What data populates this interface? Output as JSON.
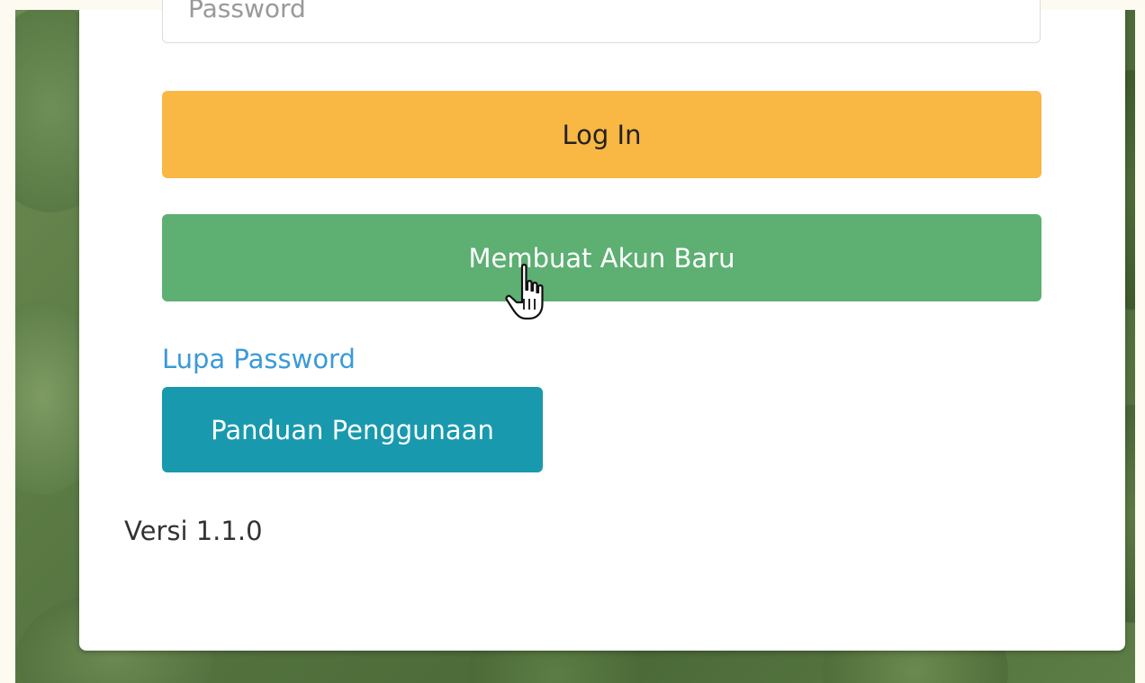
{
  "form": {
    "password_placeholder": "Password",
    "login_label": "Log In",
    "register_label": "Membuat Akun Baru",
    "forgot_label": "Lupa Password",
    "guide_label": "Panduan Penggunaan",
    "version_text": "Versi 1.1.0"
  },
  "colors": {
    "login_button": "#f9b744",
    "register_button": "#5daf72",
    "guide_button": "#1899ae",
    "link": "#3a9ad9"
  },
  "cursor": {
    "icon": "hand-pointer-icon"
  }
}
